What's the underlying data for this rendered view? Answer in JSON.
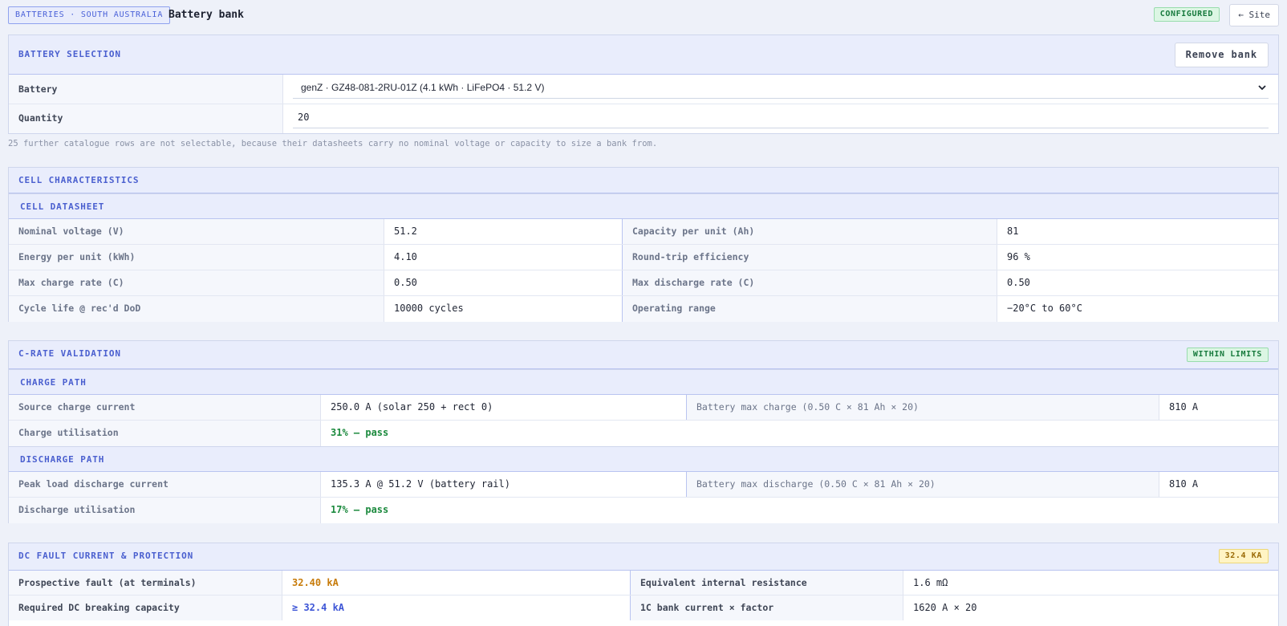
{
  "header": {
    "breadcrumb": "BATTERIES · SOUTH AUSTRALIA",
    "title": "Battery bank",
    "status": "CONFIGURED",
    "site_button": "← Site"
  },
  "selection": {
    "heading": "BATTERY SELECTION",
    "remove_label": "Remove bank",
    "battery_label": "Battery",
    "battery_value": "genZ · GZ48-081-2RU-01Z (4.1 kWh · LiFePO4 · 51.2 V)",
    "quantity_label": "Quantity",
    "quantity_value": "20",
    "note": "25 further catalogue rows are not selectable, because their datasheets carry no nominal voltage or capacity to size a bank from."
  },
  "cell": {
    "heading": "CELL CHARACTERISTICS",
    "subheading": "CELL DATASHEET",
    "rows": [
      {
        "l1": "Nominal voltage (V)",
        "v1": "51.2",
        "l2": "Capacity per unit (Ah)",
        "v2": "81"
      },
      {
        "l1": "Energy per unit (kWh)",
        "v1": "4.10",
        "l2": "Round-trip efficiency",
        "v2": "96 %"
      },
      {
        "l1": "Max charge rate (C)",
        "v1": "0.50",
        "l2": "Max discharge rate (C)",
        "v2": "0.50"
      },
      {
        "l1": "Cycle life @ rec'd DoD",
        "v1": "10000 cycles",
        "l2": "Operating range",
        "v2": "−20°C to 60°C"
      }
    ]
  },
  "crate": {
    "heading": "C-RATE VALIDATION",
    "badge": "WITHIN LIMITS",
    "charge": {
      "subheading": "CHARGE PATH",
      "source_label": "Source charge current",
      "source_value": "250.0 A (solar 250 + rect 0)",
      "max_label": "Battery max charge (0.50 C × 81 Ah × 20)",
      "max_value": "810 A",
      "util_label": "Charge utilisation",
      "util_value": "31% — pass"
    },
    "discharge": {
      "subheading": "DISCHARGE PATH",
      "source_label": "Peak load discharge current",
      "source_value": "135.3 A @ 51.2 V (battery rail)",
      "max_label": "Battery max discharge (0.50 C × 81 Ah × 20)",
      "max_value": "810 A",
      "util_label": "Discharge utilisation",
      "util_value": "17% — pass"
    }
  },
  "fault": {
    "heading": "DC FAULT CURRENT & PROTECTION",
    "badge": "32.4 KA",
    "rows": [
      {
        "l1": "Prospective fault (at terminals)",
        "v1": "32.40 kA",
        "l2": "Equivalent internal resistance",
        "v2": "1.6 mΩ"
      },
      {
        "l1": "Required DC breaking capacity",
        "v1": "≥ 32.4 kA",
        "l2": "1C bank current × factor",
        "v2": "1620 A × 20"
      }
    ]
  },
  "colors": {
    "accent": "#4a5fcf",
    "pass": "#1c8a3e",
    "warn": "#c77b0a"
  }
}
